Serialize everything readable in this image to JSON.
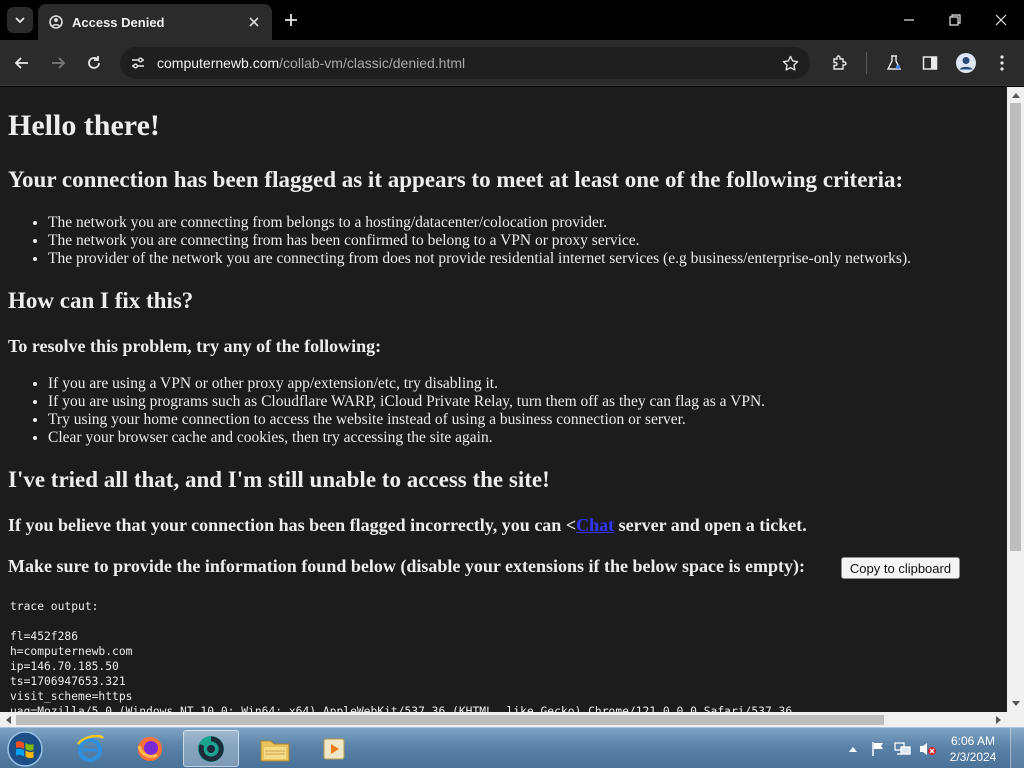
{
  "browser": {
    "tab_title": "Access Denied",
    "url_host": "computernewb.com",
    "url_path": "/collab-vm/classic/denied.html"
  },
  "page": {
    "greeting": "Hello there!",
    "flagged_heading": "Your connection has been flagged as it appears to meet at least one of the following criteria:",
    "criteria": [
      "The network you are connecting from belongs to a hosting/datacenter/colocation provider.",
      "The network you are connecting from has been confirmed to belong to a VPN or proxy service.",
      "The provider of the network you are connecting from does not provide residential internet services (e.g business/enterprise-only networks)."
    ],
    "fix_heading": "How can I fix this?",
    "resolve_heading": "To resolve this problem, try any of the following:",
    "fixes": [
      "If you are using a VPN or other proxy app/extension/etc, try disabling it.",
      "If you are using programs such as Cloudflare WARP, iCloud Private Relay, turn them off as they can flag as a VPN.",
      "Try using your home connection to access the website instead of using a business connection or server.",
      "Clear your browser cache and cookies, then try accessing the site again."
    ],
    "still_heading": "I've tried all that, and I'm still unable to access the site!",
    "incorrect_prefix": "If you believe that your connection has been flagged incorrectly, you can <",
    "incorrect_link": "Chat",
    "incorrect_suffix": " server and open a ticket.",
    "provide_text": "Make sure to provide the information found below (disable your extensions if the below space is empty):",
    "copy_button": "Copy to clipboard",
    "trace_output": "trace output:\n\nfl=452f286\nh=computernewb.com\nip=146.70.185.50\nts=1706947653.321\nvisit_scheme=https\nuag=Mozilla/5.0 (Windows NT 10.0; Win64; x64) AppleWebKit/537.36 (KHTML, like Gecko) Chrome/121.0.0.0 Safari/537.36"
  },
  "taskbar": {
    "time": "6:06 AM",
    "date": "2/3/2024"
  },
  "colors": {
    "page_bg": "#1c1c1c",
    "link": "#3333ff",
    "chrome_bg": "#2b2b2b"
  }
}
